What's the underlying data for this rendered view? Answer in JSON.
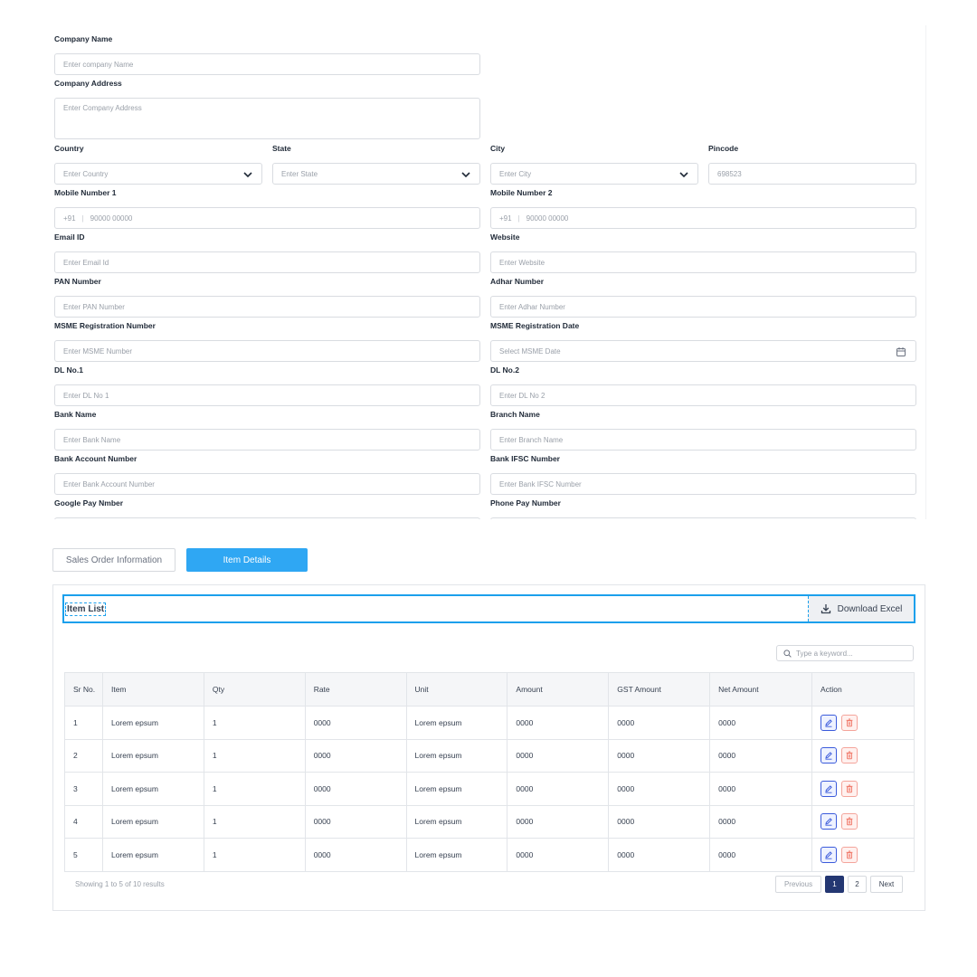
{
  "form": {
    "company_name": {
      "label": "Company Name",
      "placeholder": "Enter company Name"
    },
    "company_address": {
      "label": "Company Address",
      "placeholder": "Enter Company Address"
    },
    "country": {
      "label": "Country",
      "placeholder": "Enter Country"
    },
    "state": {
      "label": "State",
      "placeholder": "Enter State"
    },
    "city": {
      "label": "City",
      "placeholder": "Enter City"
    },
    "pincode": {
      "label": "Pincode",
      "value": "698523"
    },
    "mobile1": {
      "label": "Mobile Number 1",
      "code": "+91",
      "placeholder": "90000 00000"
    },
    "mobile2": {
      "label": "Mobile Number 2",
      "code": "+91",
      "placeholder": "90000 00000"
    },
    "email": {
      "label": "Email ID",
      "placeholder": "Enter Email Id"
    },
    "website": {
      "label": "Website",
      "placeholder": "Enter Website"
    },
    "pan": {
      "label": "PAN Number",
      "placeholder": "Enter PAN Number"
    },
    "adhar": {
      "label": "Adhar Number",
      "placeholder": "Enter Adhar Number"
    },
    "msme_number": {
      "label": "MSME Registration Number",
      "placeholder": "Enter MSME Number"
    },
    "msme_date": {
      "label": "MSME Registration Date",
      "placeholder": "Select MSME Date"
    },
    "dl1": {
      "label": "DL No.1",
      "placeholder": "Enter DL No 1"
    },
    "dl2": {
      "label": "DL No.2",
      "placeholder": "Enter DL No 2"
    },
    "bank_name": {
      "label": "Bank Name",
      "placeholder": "Enter Bank Name"
    },
    "branch_name": {
      "label": "Branch Name",
      "placeholder": "Enter Branch Name"
    },
    "bank_account": {
      "label": "Bank Account Number",
      "placeholder": "Enter Bank Account Number"
    },
    "bank_ifsc": {
      "label": "Bank IFSC Number",
      "placeholder": "Enter Bank IFSC Number"
    },
    "google_pay": {
      "label": "Google Pay Nmber"
    },
    "phone_pay": {
      "label": "Phone Pay Number"
    }
  },
  "tabs": [
    {
      "label": "Sales Order Information",
      "active": false
    },
    {
      "label": "Item Details",
      "active": true
    }
  ],
  "items_panel": {
    "title": "Item List",
    "download_label": "Download Excel",
    "search_placeholder": "Type a keyword...",
    "columns": [
      "Sr No.",
      "Item",
      "Qty",
      "Rate",
      "Unit",
      "Amount",
      "GST Amount",
      "Net Amount",
      "Action"
    ],
    "rows": [
      [
        "1",
        "Lorem epsum",
        "1",
        "0000",
        "Lorem epsum",
        "0000",
        "0000",
        "0000"
      ],
      [
        "2",
        "Lorem epsum",
        "1",
        "0000",
        "Lorem epsum",
        "0000",
        "0000",
        "0000"
      ],
      [
        "3",
        "Lorem epsum",
        "1",
        "0000",
        "Lorem epsum",
        "0000",
        "0000",
        "0000"
      ],
      [
        "4",
        "Lorem epsum",
        "1",
        "0000",
        "Lorem epsum",
        "0000",
        "0000",
        "0000"
      ],
      [
        "5",
        "Lorem epsum",
        "1",
        "0000",
        "Lorem epsum",
        "0000",
        "0000",
        "0000"
      ]
    ],
    "showing_text": "Showing 1 to 5 of 10 results",
    "pagination": {
      "previous": "Previous",
      "pages": [
        "1",
        "2"
      ],
      "current": "1",
      "next": "Next"
    }
  },
  "colors": {
    "accent": "#2fa7f3",
    "highlight": "#1ba0ec",
    "page_active": "#243772",
    "edit": "#3b5bdb",
    "delete": "#f07a6b"
  }
}
